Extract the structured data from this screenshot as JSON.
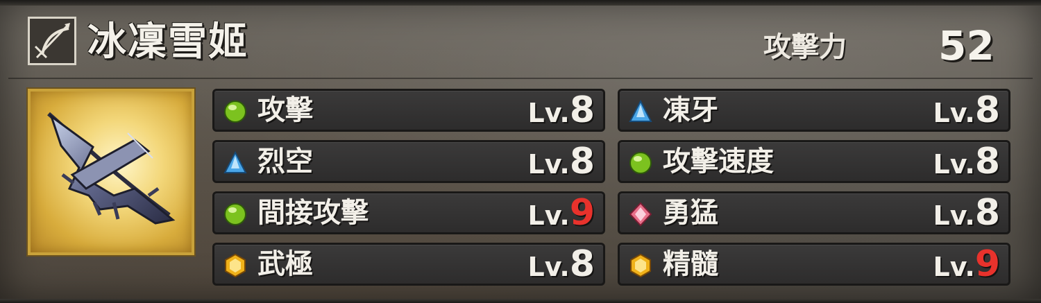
{
  "weapon": {
    "icon": "bow-icon",
    "name": "冰凜雪姬",
    "attack_label": "攻擊力",
    "attack_value": "52",
    "portrait": "ice-bow-image"
  },
  "level_prefix": "Lv.",
  "colors": {
    "max_level": "#e8322c",
    "normal_level": "#f2efe8",
    "gem_green": "#7cc21f",
    "gem_blue": "#4aa6e8",
    "gem_pink": "#e8708a",
    "gem_yellow": "#f0b21a"
  },
  "skills": [
    {
      "gem": "green-orb-icon",
      "name": "攻擊",
      "level": "8",
      "max": false
    },
    {
      "gem": "blue-triangle-icon",
      "name": "凍牙",
      "level": "8",
      "max": false
    },
    {
      "gem": "blue-triangle-icon",
      "name": "烈空",
      "level": "8",
      "max": false
    },
    {
      "gem": "green-orb-icon",
      "name": "攻擊速度",
      "level": "8",
      "max": false
    },
    {
      "gem": "green-orb-icon",
      "name": "間接攻擊",
      "level": "9",
      "max": true
    },
    {
      "gem": "pink-diamond-icon",
      "name": "勇猛",
      "level": "8",
      "max": false
    },
    {
      "gem": "yellow-hexagon-icon",
      "name": "武極",
      "level": "8",
      "max": false
    },
    {
      "gem": "yellow-hexagon-icon",
      "name": "精髓",
      "level": "9",
      "max": true
    }
  ]
}
